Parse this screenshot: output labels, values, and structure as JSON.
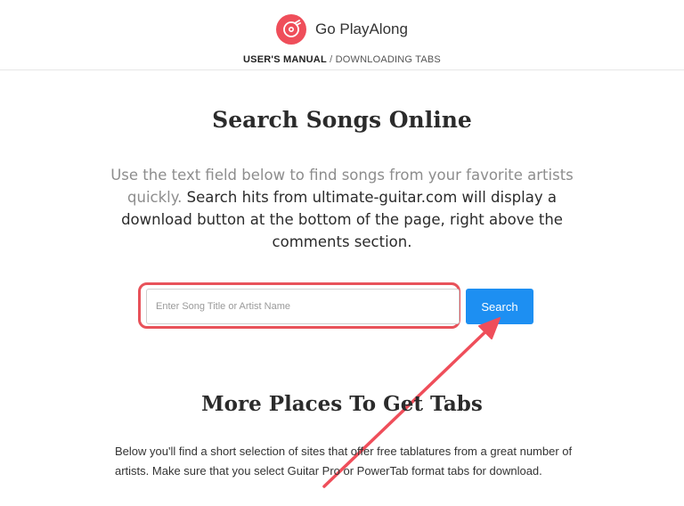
{
  "header": {
    "brand": "Go PlayAlong",
    "logo_icon": "play-along-logo-icon",
    "accent_color": "#ef4e5a",
    "breadcrumb": {
      "section": "USER'S MANUAL",
      "separator": " / ",
      "page": "DOWNLOADING TABS"
    }
  },
  "main": {
    "title": "Search Songs Online",
    "intro_muted": "Use the text field below to find songs from your favorite artists quickly.",
    "intro_rest": " Search hits from ultimate-guitar.com will display a download button at the bottom of the page, right above the comments section.",
    "search": {
      "placeholder": "Enter Song Title or Artist Name",
      "value": "",
      "button_label": "Search",
      "button_color": "#1d8ff2",
      "highlight_color": "#e8525a"
    },
    "subtitle": "More Places To Get Tabs",
    "paragraph": "Below you'll find a short selection of sites that offer free tablatures from a great number of artists. Make sure that you select Guitar Pro or PowerTab format tabs for download."
  }
}
